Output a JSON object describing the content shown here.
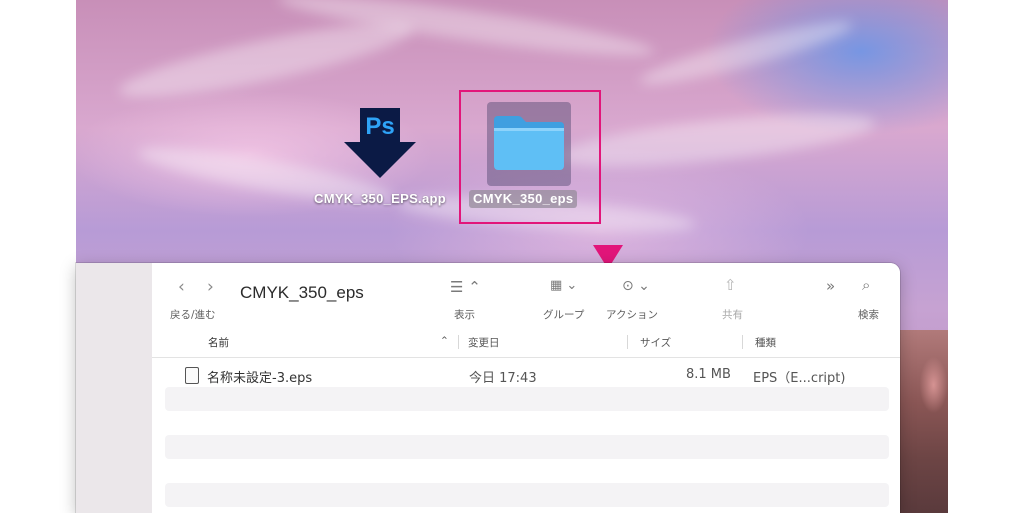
{
  "desktop": {
    "app_icon_text": "Ps",
    "app_label": "CMYK_350_EPS.app",
    "folder_label": "CMYK_350_eps"
  },
  "colors": {
    "highlight": "#e2157a",
    "folder_blue": "#4fb3f0",
    "ps_navy": "#0b1a45",
    "ps_text": "#2fa3f7"
  },
  "finder": {
    "title": "CMYK_350_eps",
    "toolbar": {
      "back_forward_label": "戻る/進む",
      "view_label": "表示",
      "group_label": "グループ",
      "action_label": "アクション",
      "share_label": "共有",
      "search_label": "検索"
    },
    "columns": {
      "name": "名前",
      "modified": "変更日",
      "size": "サイズ",
      "kind": "種類"
    },
    "files": [
      {
        "name": "名称未設定-3.eps",
        "modified": "今日 17:43",
        "size": "8.1 MB",
        "kind": "EPS（E...cript)"
      }
    ]
  }
}
